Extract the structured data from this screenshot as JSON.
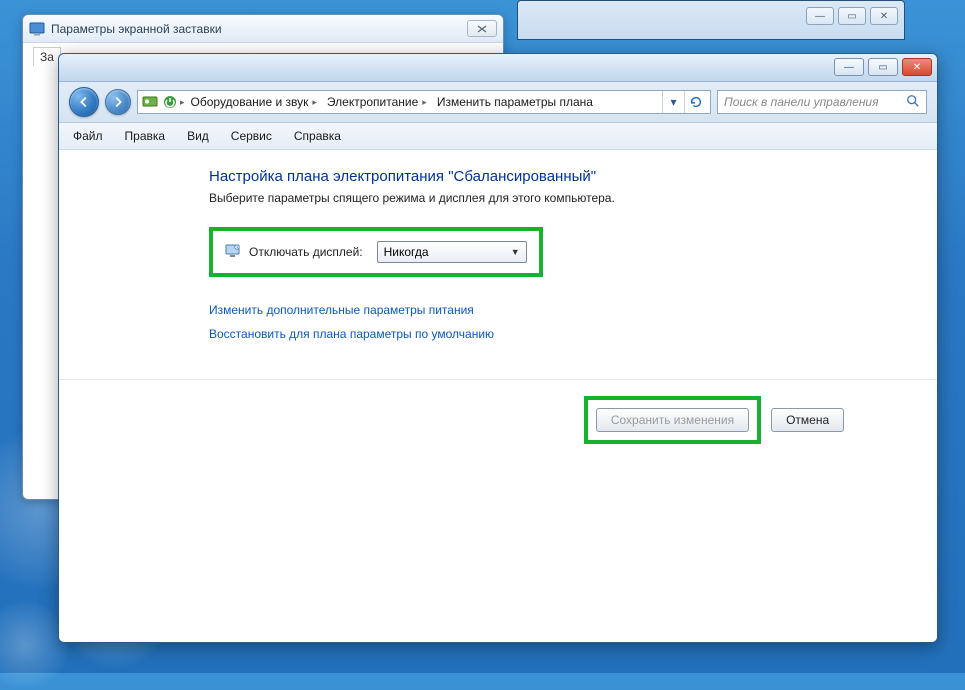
{
  "bg_window": {
    "title": "Параметры экранной заставки",
    "tab_label": "За"
  },
  "bg_explorer_ctrls": {
    "min": "—",
    "max": "▭",
    "close": "✕"
  },
  "main_window": {
    "ctrls": {
      "min": "—",
      "max": "▭",
      "close": "✕"
    },
    "breadcrumbs": [
      "Оборудование и звук",
      "Электропитание",
      "Изменить параметры плана"
    ],
    "search_placeholder": "Поиск в панели управления",
    "menu": [
      "Файл",
      "Правка",
      "Вид",
      "Сервис",
      "Справка"
    ],
    "heading": "Настройка плана электропитания \"Сбалансированный\"",
    "subheading": "Выберите параметры спящего режима и дисплея для этого компьютера.",
    "option_label": "Отключать дисплей:",
    "option_value": "Никогда",
    "link_advanced": "Изменить дополнительные параметры питания",
    "link_restore": "Восстановить для плана параметры по умолчанию",
    "btn_save": "Сохранить изменения",
    "btn_cancel": "Отмена"
  }
}
